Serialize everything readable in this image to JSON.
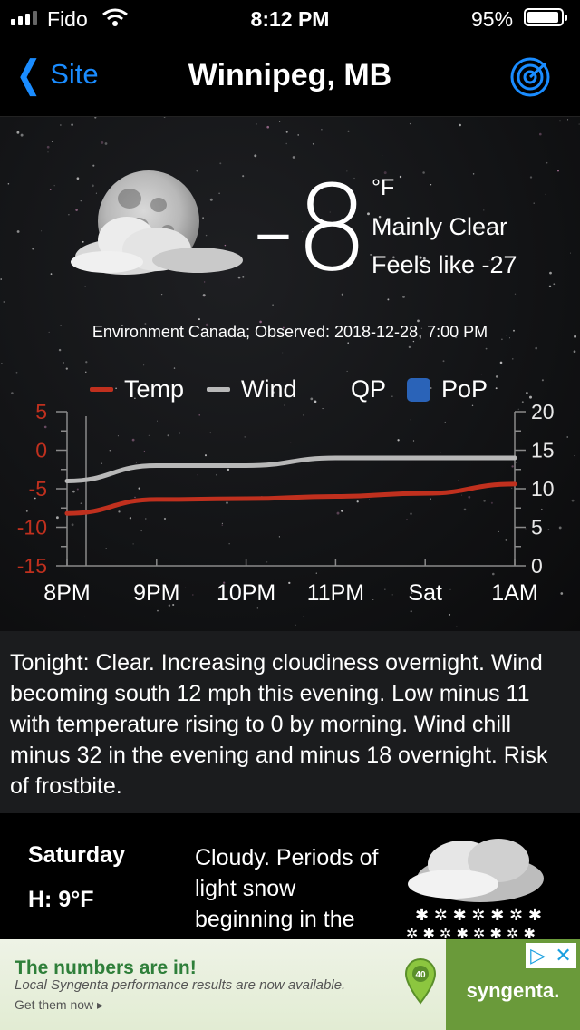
{
  "status": {
    "carrier": "Fido",
    "time": "8:12 PM",
    "battery": "95%"
  },
  "nav": {
    "back_label": "Site",
    "title": "Winnipeg, MB",
    "radar_icon": "radar-icon"
  },
  "current": {
    "temp": "-8",
    "unit": "°F",
    "condition": "Mainly Clear",
    "feels_like": "Feels like -27",
    "observed": "Environment Canada; Observed: 2018-12-28, 7:00 PM",
    "icon": "moon-cloud-icon"
  },
  "legend": {
    "temp": "Temp",
    "wind": "Wind",
    "qp": "QP",
    "pop": "PoP"
  },
  "colors": {
    "temp": "#c0301e",
    "wind": "#b8b8b8",
    "pop": "#2a63b8",
    "accent": "#1a8cff",
    "left_axis": "#c0301e"
  },
  "chart_data": {
    "type": "line",
    "x": [
      "8PM",
      "9PM",
      "10PM",
      "11PM",
      "Sat",
      "1AM"
    ],
    "series": [
      {
        "name": "Temp",
        "axis": "left",
        "values": [
          -8.2,
          -6.4,
          -6.3,
          -6.0,
          -5.6,
          -4.4
        ]
      },
      {
        "name": "Wind",
        "axis": "right",
        "values": [
          11,
          13,
          13,
          14,
          14,
          14
        ]
      }
    ],
    "left_axis": {
      "ticks": [
        "5",
        "0",
        "-5",
        "-10",
        "-15"
      ],
      "ylim": [
        -15,
        5
      ]
    },
    "right_axis": {
      "ticks": [
        "20",
        "15",
        "10",
        "5",
        "0"
      ],
      "ylim": [
        0,
        20
      ]
    },
    "legend": [
      "Temp",
      "Wind",
      "QP",
      "PoP"
    ],
    "now_marker": "8PM"
  },
  "forecast_text": "Tonight:  Clear. Increasing cloudiness overnight. Wind becoming south 12 mph this evening. Low minus 11 with temperature rising to 0 by morning. Wind chill minus 32 in the evening and minus 18 overnight. Risk of frostbite.",
  "day": {
    "name": "Saturday",
    "high": "H: 9°F",
    "text": "Cloudy. Periods of light snow beginning in the morning. Wind",
    "icon": "cloud-snow-icon"
  },
  "ad": {
    "title": "The numbers are in!",
    "subtitle": "Local Syngenta performance results are now available.",
    "cta": "Get them now ▸",
    "badge": "40",
    "brand": "syngenta."
  }
}
